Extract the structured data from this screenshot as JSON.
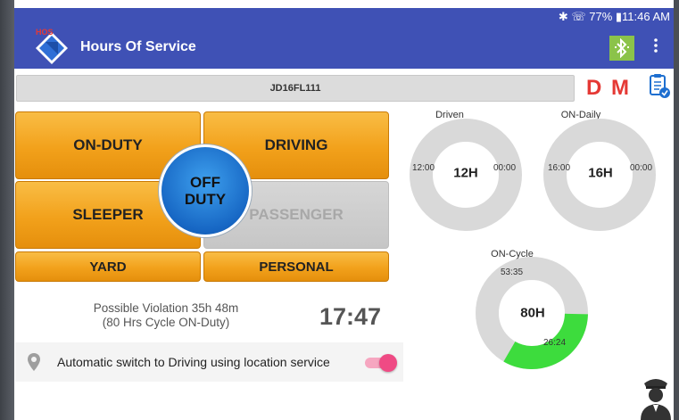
{
  "status_bar": {
    "text": "✱ ☏ 77% ▮11:46 AM"
  },
  "app_bar": {
    "logo_text": "HOS",
    "title": "Hours Of Service"
  },
  "vehicle_id": "JD16FL111",
  "badges": {
    "d": "D",
    "m": "M"
  },
  "duty_buttons": {
    "on_duty": "ON-DUTY",
    "driving": "DRIVING",
    "sleeper": "SLEEPER",
    "passenger": "PASSENGER",
    "yard": "YARD",
    "personal": "PERSONAL",
    "off_duty_line1": "OFF",
    "off_duty_line2": "DUTY"
  },
  "violation": {
    "line1": "Possible Violation 35h 48m",
    "line2": "(80 Hrs Cycle ON-Duty)"
  },
  "clock": "17:47",
  "auto_switch": {
    "label": "Automatic switch to Driving using location service",
    "enabled": true
  },
  "gauges": {
    "driven": {
      "title": "Driven",
      "center": "12H",
      "left": "12:00",
      "right": "00:00",
      "used_fraction": 0
    },
    "on_daily": {
      "title": "ON-Daily",
      "center": "16H",
      "left": "16:00",
      "right": "00:00",
      "used_fraction": 0
    },
    "on_cycle": {
      "title": "ON-Cycle",
      "center": "80H",
      "remaining": "53:35",
      "used": "26:24",
      "used_fraction": 0.33
    }
  },
  "colors": {
    "primary": "#3f51b5",
    "accent_orange": "#f2a11b",
    "off_duty_blue": "#1767c4",
    "used_green": "#3ddc3d",
    "ring_grey": "#d9d9d9",
    "badge_red": "#e53935"
  },
  "icons": [
    "hos-logo-icon",
    "bluetooth-icon",
    "overflow-menu-icon",
    "clipboard-check-icon",
    "location-pin-icon",
    "officer-icon"
  ]
}
